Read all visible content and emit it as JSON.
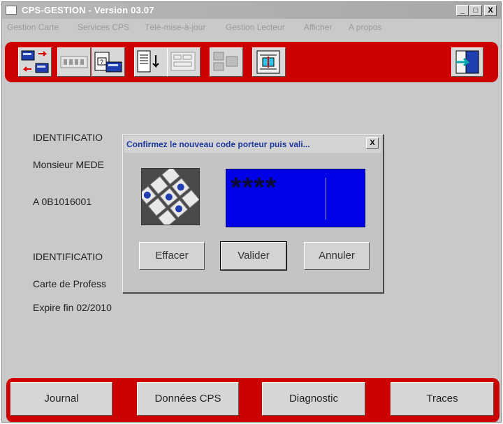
{
  "window": {
    "title": "CPS-GESTION - Version 03.07",
    "controls": {
      "minimize": "_",
      "maximize": "□",
      "close": "X"
    }
  },
  "menubar": {
    "items": [
      "Gestion Carte",
      "Services CPS",
      "Télé-mise-à-jour",
      "Gestion Lecteur",
      "Afficher",
      "A propos"
    ]
  },
  "toolbar": {
    "buttons": [
      {
        "icon": "card-exchange-icon"
      },
      {
        "icon": "card-pin-icon"
      },
      {
        "icon": "card-lock-icon"
      },
      {
        "icon": "document-download-icon"
      },
      {
        "icon": "settings-disabled-icon"
      },
      {
        "icon": "reader-transfer-icon"
      },
      {
        "icon": "exit-door-icon"
      }
    ]
  },
  "main": {
    "identification_1": "IDENTIFICATIO",
    "holder_name": "Monsieur MEDE",
    "holder_id": "A 0B1016001",
    "identification_2": "IDENTIFICATIO",
    "card_type": "Carte de Profess",
    "expiry": "Expire fin 02/2010"
  },
  "dialog": {
    "title": "Confirmez le nouveau code porteur puis vali...",
    "close": "X",
    "pin_mask": "****",
    "keypad_icon": "keypad-icon",
    "buttons": {
      "clear": "Effacer",
      "validate": "Valider",
      "cancel": "Annuler"
    }
  },
  "bottom_buttons": {
    "journal": "Journal",
    "donnees": "Données CPS",
    "diagnostic": "Diagnostic",
    "traces": "Traces"
  },
  "colors": {
    "accent_red": "#cc0000",
    "pin_field_blue": "#0000e8",
    "dialog_title_text": "#1a38a0",
    "window_bg": "#c9c9c9"
  }
}
